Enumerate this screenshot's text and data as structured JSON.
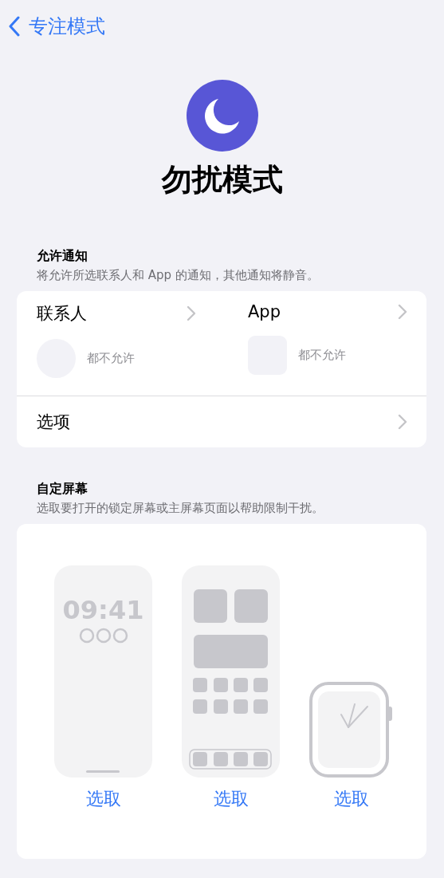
{
  "nav": {
    "back_label": "专注模式"
  },
  "focus": {
    "title": "勿扰模式"
  },
  "allow_section": {
    "header": "允许通知",
    "subtitle": "将允许所选联系人和 App 的通知，其他通知将静音。",
    "columns": [
      {
        "kind": "contacts",
        "label": "联系人",
        "status": "都不允许"
      },
      {
        "kind": "apps",
        "label": "App",
        "status": "都不允许"
      }
    ],
    "options_label": "选项"
  },
  "screens_section": {
    "header": "自定屏幕",
    "subtitle": "选取要打开的锁定屏幕或主屏幕页面以帮助限制干扰。",
    "screens": [
      {
        "kind": "lock",
        "clock": "09:41",
        "action": "选取"
      },
      {
        "kind": "home",
        "action": "选取"
      },
      {
        "kind": "watch",
        "action": "选取"
      }
    ]
  }
}
